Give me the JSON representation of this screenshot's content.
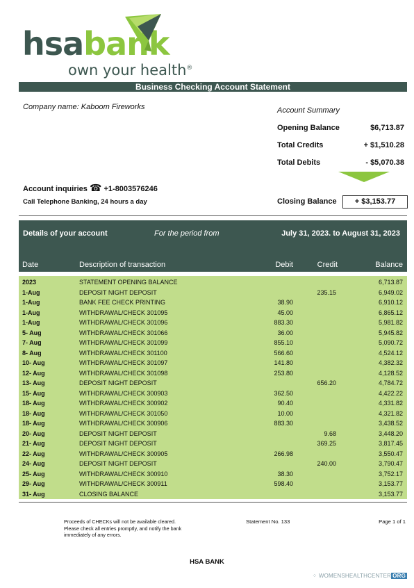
{
  "logo": {
    "word_hsa": "hsa",
    "word_bank": "bank",
    "tagline": "own your health",
    "tag_mark": "®"
  },
  "title": "Business Checking Account Statement",
  "company_label": "Company name: Kaboom Fireworks",
  "summary": {
    "heading": "Account Summary",
    "opening_label": "Opening Balance",
    "opening_value": "$6,713.87",
    "credits_label": "Total Credits",
    "credits_value": "+ $1,510.28",
    "debits_label": "Total Debits",
    "debits_value": "- $5,070.38",
    "closing_label": "Closing Balance",
    "closing_value": "+ $3,153.77"
  },
  "inquiries": {
    "label": "Account inquiries",
    "phone_icon": "☎",
    "phone": "+1-8003576246",
    "call_text": "Call Telephone Banking, 24 hours a day"
  },
  "details": {
    "title": "Details of your account",
    "period_label": "For the period from",
    "period_range": "July 31, 2023. to August 31, 2023",
    "col_date": "Date",
    "col_desc": "Description of transaction",
    "col_debit": "Debit",
    "col_credit": "Credit",
    "col_balance": "Balance"
  },
  "transactions": [
    {
      "date": "2023",
      "desc": "STATEMENT OPENING BALANCE",
      "debit": "",
      "credit": "",
      "balance": "6,713.87"
    },
    {
      "date": "1-Aug",
      "desc": "DEPOSIT NIGHT DEPOSIT",
      "debit": "",
      "credit": "235.15",
      "balance": "6,949.02"
    },
    {
      "date": "1-Aug",
      "desc": "BANK FEE CHECK PRINTING",
      "debit": "38.90",
      "credit": "",
      "balance": "6,910.12"
    },
    {
      "date": "1-Aug",
      "desc": "WITHDRAWAL/CHECK 301095",
      "debit": "45.00",
      "credit": "",
      "balance": "6,865.12"
    },
    {
      "date": "1-Aug",
      "desc": "WITHDRAWAL/CHECK 301096",
      "debit": "883.30",
      "credit": "",
      "balance": "5,981.82"
    },
    {
      "date": "5- Aug",
      "desc": "WITHDRAWAL/CHECK 301066",
      "debit": "36.00",
      "credit": "",
      "balance": "5,945.82"
    },
    {
      "date": "7- Aug",
      "desc": "WITHDRAWAL/CHECK 301099",
      "debit": "855.10",
      "credit": "",
      "balance": "5,090.72"
    },
    {
      "date": "8- Aug",
      "desc": "WITHDRAWAL/CHECK 301100",
      "debit": "566.60",
      "credit": "",
      "balance": "4,524.12"
    },
    {
      "date": "10- Aug",
      "desc": "WITHDRAWAL/CHECK 301097",
      "debit": "141.80",
      "credit": "",
      "balance": "4,382.32"
    },
    {
      "date": "12- Aug",
      "desc": "WITHDRAWAL/CHECK 301098",
      "debit": "253.80",
      "credit": "",
      "balance": "4,128.52"
    },
    {
      "date": "13- Aug",
      "desc": "DEPOSIT NIGHT DEPOSIT",
      "debit": "",
      "credit": "656.20",
      "balance": "4,784.72"
    },
    {
      "date": "15- Aug",
      "desc": "WITHDRAWAL/CHECK 300903",
      "debit": "362.50",
      "credit": "",
      "balance": "4,422.22"
    },
    {
      "date": "18- Aug",
      "desc": "WITHDRAWAL/CHECK 300902",
      "debit": "90.40",
      "credit": "",
      "balance": "4,331.82"
    },
    {
      "date": "18- Aug",
      "desc": "WITHDRAWAL/CHECK 301050",
      "debit": "10.00",
      "credit": "",
      "balance": "4,321.82"
    },
    {
      "date": "18- Aug",
      "desc": "WITHDRAWAL/CHECK 300906",
      "debit": "883.30",
      "credit": "",
      "balance": "3,438.52"
    },
    {
      "date": "20- Aug",
      "desc": "DEPOSIT NIGHT DEPOSIT",
      "debit": "",
      "credit": "9.68",
      "balance": "3,448.20"
    },
    {
      "date": "21- Aug",
      "desc": "DEPOSIT NIGHT DEPOSIT",
      "debit": "",
      "credit": "369.25",
      "balance": "3,817.45"
    },
    {
      "date": "22- Aug",
      "desc": "WITHDRAWAL/CHECK 300905",
      "debit": "266.98",
      "credit": "",
      "balance": "3,550.47"
    },
    {
      "date": "24- Aug",
      "desc": "DEPOSIT NIGHT DEPOSIT",
      "debit": "",
      "credit": "240.00",
      "balance": "3,790.47"
    },
    {
      "date": "25- Aug",
      "desc": "WITHDRAWAL/CHECK 300910",
      "debit": "38.30",
      "credit": "",
      "balance": "3,752.17"
    },
    {
      "date": "29- Aug",
      "desc": "WITHDRAWAL/CHECK 300911",
      "debit": "598.40",
      "credit": "",
      "balance": "3,153.77"
    },
    {
      "date": "31- Aug",
      "desc": "CLOSING BALANCE",
      "debit": "",
      "credit": "",
      "balance": "3,153.77"
    }
  ],
  "footer": {
    "note": "Proceeds of CHECKs will not be available cleared. Please check all entries promptly, and notify the bank immediately of any errors.",
    "statement_no": "Statement No. 133",
    "page": "Page 1 of 1",
    "bank": "HSA BANK",
    "watermark": "WOMENSHEALTHCENTER",
    "watermark_org": "ORG"
  },
  "colors": {
    "brand_dark": "#3d5750",
    "brand_green": "#8cc63f",
    "table_bg": "#c1dd8b"
  }
}
